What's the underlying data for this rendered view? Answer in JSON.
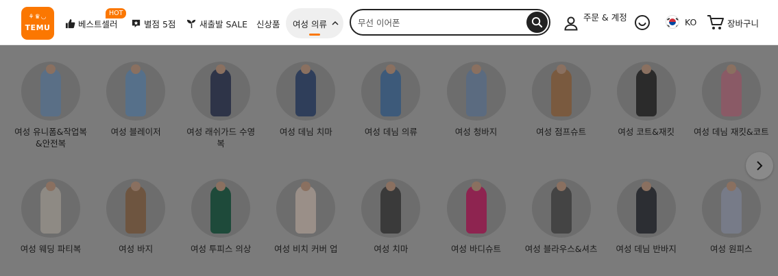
{
  "header": {
    "logo": {
      "text": "TEMU",
      "icons": "⚘♛◡"
    },
    "nav": {
      "bestsellers": "베스트셀러",
      "hot_badge": "HOT",
      "five_star": "별점 5점",
      "new_arrivals": "새출발 SALE",
      "new_products": "신상품",
      "women_clothing": "여성 의류"
    },
    "search": {
      "placeholder": "무선 이어폰",
      "value": ""
    },
    "account": {
      "label": "주문 & 계정"
    },
    "language": {
      "code": "KO"
    },
    "cart": {
      "label": "장바구니"
    }
  },
  "categories": {
    "row1": [
      {
        "label": "여성 유니폼&작업복&안전복",
        "color": "#5a6f86"
      },
      {
        "label": "여성 블레이저",
        "color": "#56708a"
      },
      {
        "label": "여성 래쉬가드 수영복",
        "color": "#2e3448"
      },
      {
        "label": "여성 데님 치마",
        "color": "#2f3e5a"
      },
      {
        "label": "여성 데님 의류",
        "color": "#3d5a7a"
      },
      {
        "label": "여성 청바지",
        "color": "#5b6b80"
      },
      {
        "label": "여성 점프슈트",
        "color": "#7a5a3f"
      },
      {
        "label": "여성 코트&재킷",
        "color": "#2b2b2b"
      },
      {
        "label": "여성 데님 재킷&코트",
        "color": "#8a5a66"
      }
    ],
    "row2": [
      {
        "label": "여성 웨딩 파티복",
        "color": "#8e8a84"
      },
      {
        "label": "여성 바지",
        "color": "#6e5540"
      },
      {
        "label": "여성 투피스 의상",
        "color": "#1e4a3a"
      },
      {
        "label": "여성 비치 커버 업",
        "color": "#9a8f88"
      },
      {
        "label": "여성 치마",
        "color": "#3a3a3a"
      },
      {
        "label": "여성 바디슈트",
        "color": "#8e2450"
      },
      {
        "label": "여성 블라우스&셔츠",
        "color": "#444444"
      },
      {
        "label": "여성 데님 반바지",
        "color": "#2c2e33"
      },
      {
        "label": "여성 원피스",
        "color": "#777b88"
      }
    ]
  },
  "colors": {
    "brand": "#fb7701",
    "overlay": "#7b7b7b"
  }
}
